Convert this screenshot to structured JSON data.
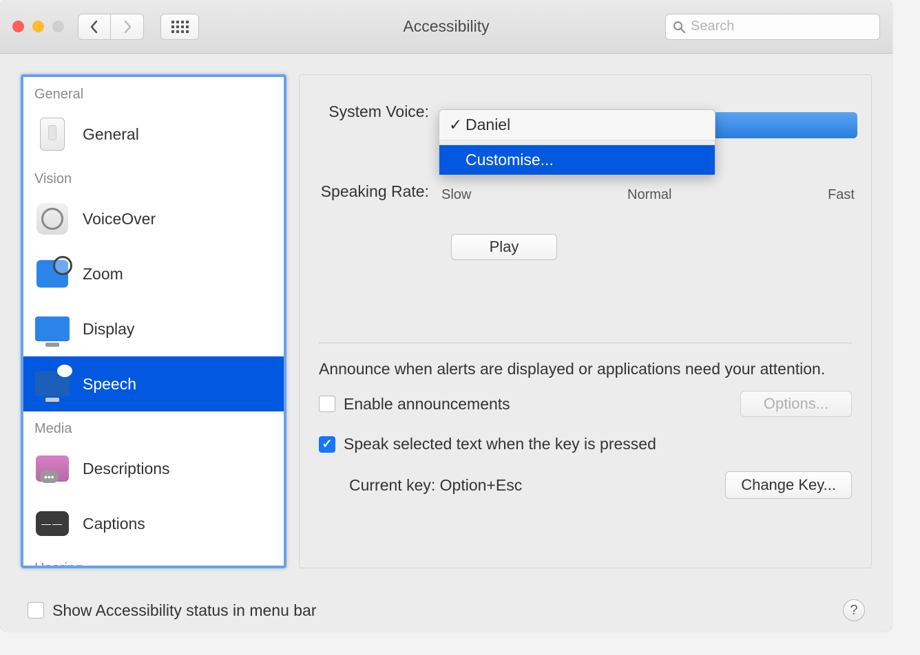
{
  "window": {
    "title": "Accessibility"
  },
  "search": {
    "placeholder": "Search"
  },
  "sidebar": {
    "sections": [
      {
        "header": "General",
        "items": [
          {
            "label": "General",
            "icon": "general"
          }
        ]
      },
      {
        "header": "Vision",
        "items": [
          {
            "label": "VoiceOver",
            "icon": "voiceover"
          },
          {
            "label": "Zoom",
            "icon": "zoom"
          },
          {
            "label": "Display",
            "icon": "display"
          },
          {
            "label": "Speech",
            "icon": "speech",
            "selected": true
          }
        ]
      },
      {
        "header": "Media",
        "items": [
          {
            "label": "Descriptions",
            "icon": "descriptions"
          },
          {
            "label": "Captions",
            "icon": "captions"
          }
        ]
      },
      {
        "header": "Hearing",
        "items": []
      }
    ]
  },
  "main": {
    "system_voice_label": "System Voice:",
    "voice_menu": {
      "selected": "Daniel",
      "customize": "Customise..."
    },
    "speaking_rate_label": "Speaking Rate:",
    "rate_ticks": {
      "slow": "Slow",
      "normal": "Normal",
      "fast": "Fast"
    },
    "play_button": "Play",
    "announce_text": "Announce when alerts are displayed or applications need your attention.",
    "enable_announcements": "Enable announcements",
    "options_button": "Options...",
    "speak_selected": "Speak selected text when the key is pressed",
    "current_key_label": "Current key: Option+Esc",
    "change_key_button": "Change Key..."
  },
  "footer": {
    "show_status": "Show Accessibility status in menu bar"
  }
}
